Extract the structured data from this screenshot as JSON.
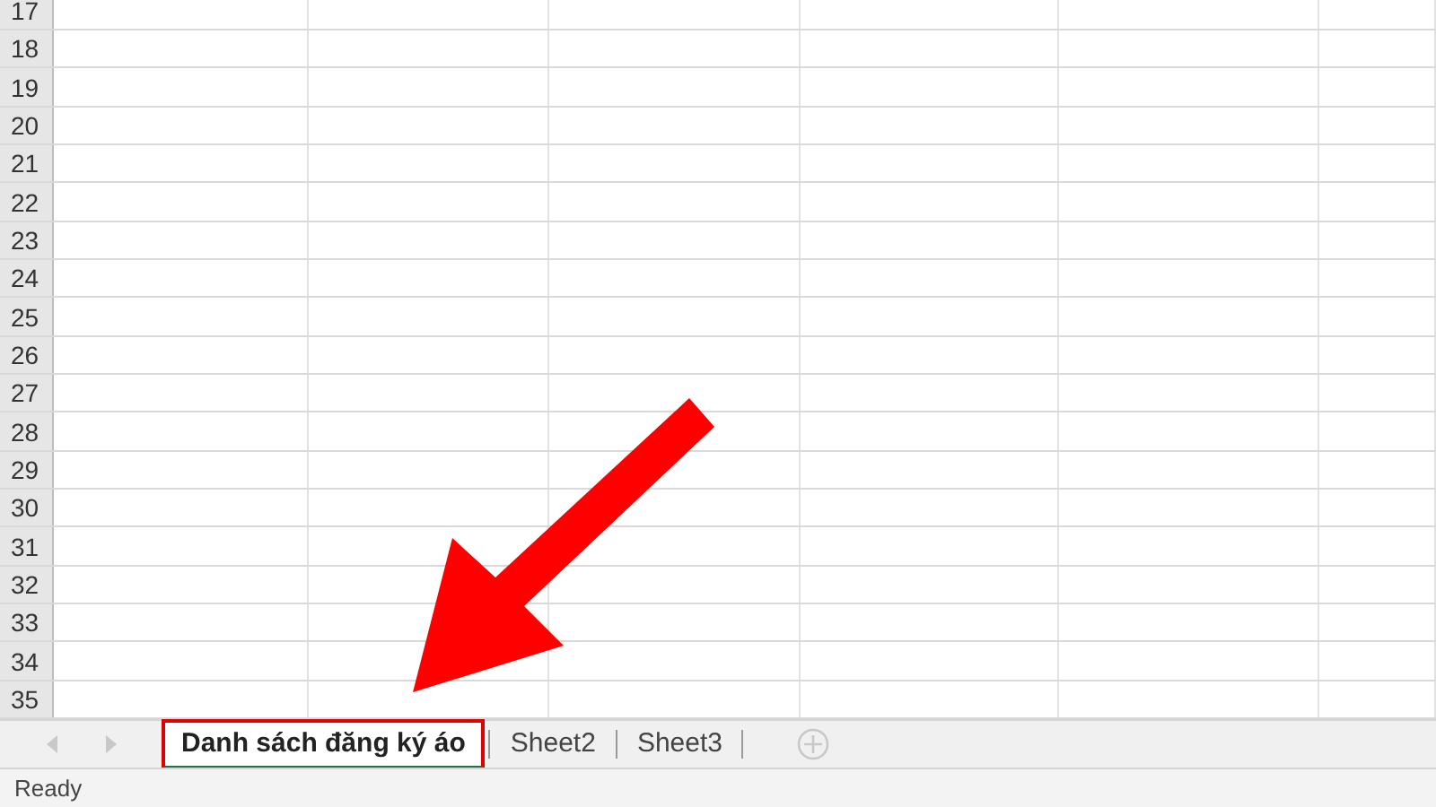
{
  "rows": [
    "17",
    "18",
    "19",
    "20",
    "21",
    "22",
    "23",
    "24",
    "25",
    "26",
    "27",
    "28",
    "29",
    "30",
    "31",
    "32",
    "33",
    "34",
    "35"
  ],
  "sheet_nav": [
    {
      "kind": "prev",
      "disabled": true
    },
    {
      "kind": "next",
      "disabled": true
    }
  ],
  "tabs": [
    {
      "label": "Danh sách đăng ký áo",
      "selected": true,
      "highlighted": true
    },
    {
      "label": "Sheet2",
      "selected": false,
      "highlighted": false
    },
    {
      "label": "Sheet3",
      "selected": false,
      "highlighted": false
    }
  ],
  "annotation": {
    "kind": "arrow"
  },
  "status_bar": {
    "text": "Ready"
  }
}
